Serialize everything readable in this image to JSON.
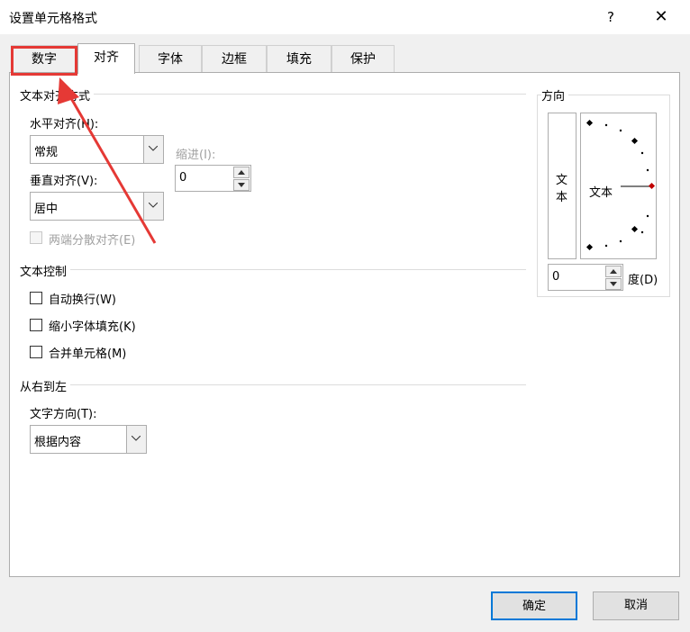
{
  "window": {
    "title": "设置单元格格式",
    "help": "?",
    "close": "✕"
  },
  "tabs": [
    {
      "label": "数字"
    },
    {
      "label": "对齐"
    },
    {
      "label": "字体"
    },
    {
      "label": "边框"
    },
    {
      "label": "填充"
    },
    {
      "label": "保护"
    }
  ],
  "alignment": {
    "section": "文本对齐方式",
    "horizontal_label": "水平对齐(H):",
    "horizontal_value": "常规",
    "indent_label": "缩进(I):",
    "indent_value": "0",
    "vertical_label": "垂直对齐(V):",
    "vertical_value": "居中",
    "distributed_label": "两端分散对齐(E)"
  },
  "text_control": {
    "section": "文本控制",
    "wrap": "自动换行(W)",
    "shrink": "缩小字体填充(K)",
    "merge": "合并单元格(M)"
  },
  "rtl": {
    "section": "从右到左",
    "direction_label": "文字方向(T):",
    "direction_value": "根据内容"
  },
  "orientation": {
    "section": "方向",
    "vertical_text_1": "文",
    "vertical_text_2": "本",
    "dial_text": "文本",
    "degree_value": "0",
    "degree_label": "度(D)"
  },
  "buttons": {
    "ok": "确定",
    "cancel": "取消"
  },
  "colors": {
    "accent": "#0078d7",
    "annotation": "#e53935"
  }
}
